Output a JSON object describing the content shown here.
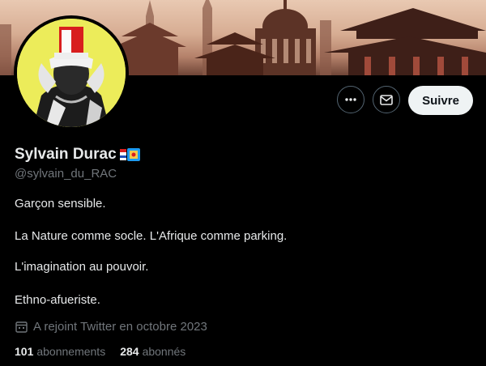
{
  "profile": {
    "display_name": "Sylvain Durac",
    "handle": "@sylvain_du_RAC",
    "follow_label": "Suivre",
    "bio": [
      "Garçon sensible.",
      "La Nature comme socle. L'Afrique comme parking.",
      "L'imagination au pouvoir.",
      "Ethno-afueriste."
    ],
    "joined": "A rejoint Twitter en octobre 2023",
    "following_count": "101",
    "following_label": "abonnements",
    "followers_count": "284",
    "followers_label": "abonnés"
  },
  "icons": {
    "more": "more-horizontal-icon",
    "message": "envelope-icon",
    "calendar": "calendar-icon"
  },
  "colors": {
    "background": "#000000",
    "text": "#e7e9ea",
    "secondary": "#71767b",
    "follow_bg": "#eff3f4"
  }
}
